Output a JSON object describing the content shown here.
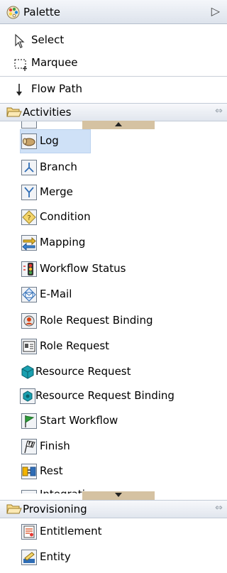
{
  "header": {
    "title": "Palette",
    "collapse_glyph": "▷",
    "icon": "palette-icon"
  },
  "tools": [
    {
      "label": "Select",
      "icon": "select-arrow-icon"
    },
    {
      "label": "Marquee",
      "icon": "marquee-icon"
    },
    {
      "label": "Flow Path",
      "icon": "flow-path-arrow-icon"
    }
  ],
  "drawers": {
    "activities": {
      "label": "Activities",
      "pin_glyph": "⇔",
      "items": [
        {
          "label": "Log",
          "icon": "log-icon",
          "selected": true
        },
        {
          "label": "Branch",
          "icon": "branch-icon"
        },
        {
          "label": "Merge",
          "icon": "merge-icon"
        },
        {
          "label": "Condition",
          "icon": "condition-icon"
        },
        {
          "label": "Mapping",
          "icon": "mapping-icon"
        },
        {
          "label": "Workflow Status",
          "icon": "workflow-status-icon"
        },
        {
          "label": "E-Mail",
          "icon": "email-icon"
        },
        {
          "label": "Role Request Binding",
          "icon": "role-request-binding-icon"
        },
        {
          "label": "Role Request",
          "icon": "role-request-icon"
        },
        {
          "label": "Resource Request",
          "icon": "resource-request-icon"
        },
        {
          "label": "Resource Request Binding",
          "icon": "resource-request-binding-icon"
        },
        {
          "label": "Start Workflow",
          "icon": "start-workflow-flag-icon"
        },
        {
          "label": "Finish",
          "icon": "finish-flag-icon"
        },
        {
          "label": "Rest",
          "icon": "rest-icon"
        },
        {
          "label": "Integration",
          "icon": "integration-icon"
        }
      ]
    },
    "provisioning": {
      "label": "Provisioning",
      "pin_glyph": "⇔",
      "items": [
        {
          "label": "Entitlement",
          "icon": "entitlement-icon"
        },
        {
          "label": "Entity",
          "icon": "entity-icon"
        }
      ]
    }
  },
  "colors": {
    "selection": "#cfe1f7",
    "scroll_button": "#d5c2a2",
    "header_border": "#b5bfcc"
  }
}
